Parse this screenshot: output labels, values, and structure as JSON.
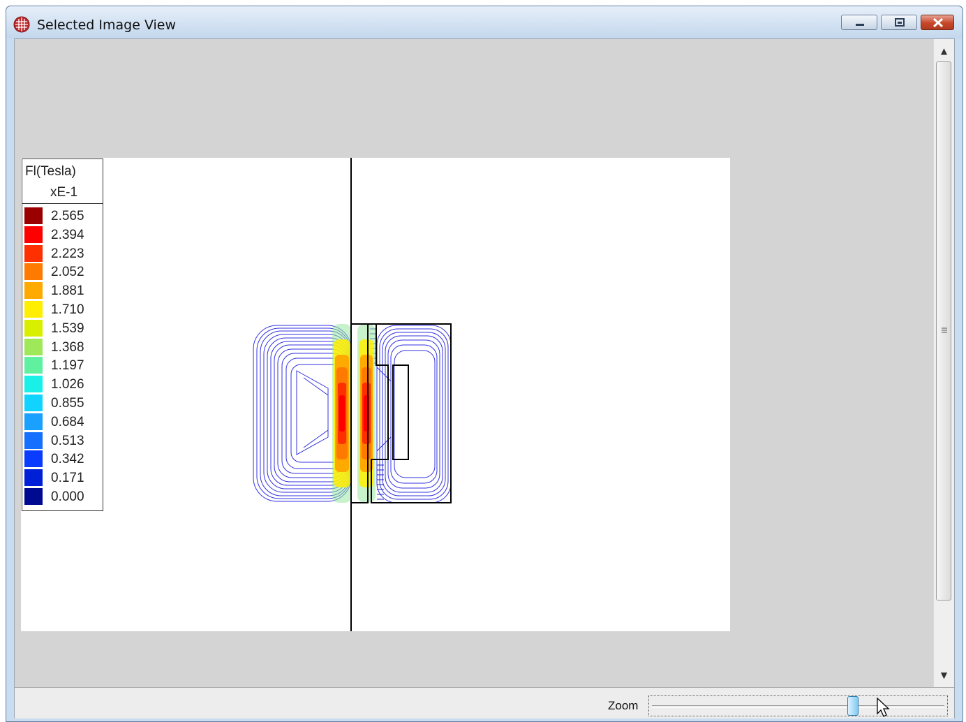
{
  "window": {
    "title": "Selected Image View",
    "icon": "grid-globe-icon",
    "controls": [
      "minimize-icon",
      "restore-icon",
      "close-icon"
    ]
  },
  "legend": {
    "title": "Fl(Tesla)",
    "scale": "xE-1",
    "items": [
      {
        "value": "2.565",
        "color": "#9b0000"
      },
      {
        "value": "2.394",
        "color": "#ff0000"
      },
      {
        "value": "2.223",
        "color": "#ff3000"
      },
      {
        "value": "2.052",
        "color": "#ff7a00"
      },
      {
        "value": "1.881",
        "color": "#ffaa00"
      },
      {
        "value": "1.710",
        "color": "#ffee00"
      },
      {
        "value": "1.539",
        "color": "#d8f000"
      },
      {
        "value": "1.368",
        "color": "#9ee85a"
      },
      {
        "value": "1.197",
        "color": "#5ff0a0"
      },
      {
        "value": "1.026",
        "color": "#19f0e8"
      },
      {
        "value": "0.855",
        "color": "#10d4ff"
      },
      {
        "value": "0.684",
        "color": "#1aa0ff"
      },
      {
        "value": "0.513",
        "color": "#1570ff"
      },
      {
        "value": "0.342",
        "color": "#0a3cff"
      },
      {
        "value": "0.171",
        "color": "#0020d8"
      },
      {
        "value": "0.000",
        "color": "#000a90"
      }
    ]
  },
  "statusbar": {
    "zoom_label": "Zoom",
    "zoom_level": 0.69
  },
  "scrollbar": {
    "up_glyph": "▲",
    "down_glyph": "▼"
  }
}
